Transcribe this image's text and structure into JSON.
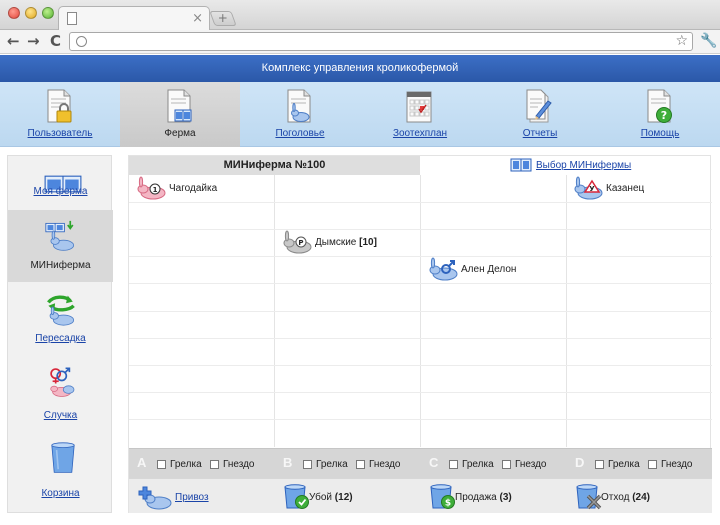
{
  "app": {
    "title": "Комплекс управления кроликофермой"
  },
  "browser": {
    "tab_close": "×",
    "new_tab": "+",
    "back": "←",
    "forward": "→",
    "reload": "C",
    "star": "☆",
    "wrench": "🔧"
  },
  "nav": [
    {
      "label": "Пользователь",
      "icon": "doc-lock-icon"
    },
    {
      "label": "Ферма",
      "icon": "doc-farm-icon"
    },
    {
      "label": "Поголовье",
      "icon": "doc-rabbit-icon"
    },
    {
      "label": "Зоотехплан",
      "icon": "doc-calendar-icon"
    },
    {
      "label": "Отчеты",
      "icon": "doc-pencil-icon"
    },
    {
      "label": "Помощь",
      "icon": "doc-help-icon"
    }
  ],
  "sidebar": [
    {
      "label": "Моя ферма",
      "icon": "cages-icon"
    },
    {
      "label": "МИНиферма",
      "icon": "miniferm-rabbit-icon"
    },
    {
      "label": "Пересадка",
      "icon": "transfer-rabbit-icon"
    },
    {
      "label": "Случка",
      "icon": "mating-icon"
    },
    {
      "label": "Корзина",
      "icon": "bin-icon"
    }
  ],
  "main": {
    "title": "МИНиферма №100",
    "choose_label": "Выбор МИНифермы"
  },
  "rabbits": [
    {
      "name": "Чагодайка",
      "badge": "1",
      "color": "#e58aa0"
    },
    {
      "name": "Казанец",
      "badge": "У",
      "color": "#8fb5e6"
    },
    {
      "name": "Дымские",
      "count": "[10]",
      "badge": "P",
      "color": "#b8b8b8"
    },
    {
      "name": "Ален Делон",
      "badge": "♂",
      "color": "#8fb5e6"
    }
  ],
  "sections": [
    {
      "letter": "A",
      "opt1": "Грелка",
      "opt2": "Гнездо"
    },
    {
      "letter": "B",
      "opt1": "Грелка",
      "opt2": "Гнездо"
    },
    {
      "letter": "C",
      "opt1": "Грелка",
      "opt2": "Гнездо"
    },
    {
      "letter": "D",
      "opt1": "Грелка",
      "opt2": "Гнездо"
    }
  ],
  "actions": [
    {
      "label": "Привоз",
      "icon": "add-rabbit-icon"
    },
    {
      "label": "Убой",
      "count": "(12)",
      "icon": "slaughter-bin-icon"
    },
    {
      "label": "Продажа",
      "count": "(3)",
      "icon": "sale-bin-icon"
    },
    {
      "label": "Отход",
      "count": "(24)",
      "icon": "waste-bin-icon"
    }
  ],
  "colors": {
    "header_blue": "#2f5fb4",
    "nav_bg": "#c6def4",
    "link_blue": "#1a44a8"
  }
}
